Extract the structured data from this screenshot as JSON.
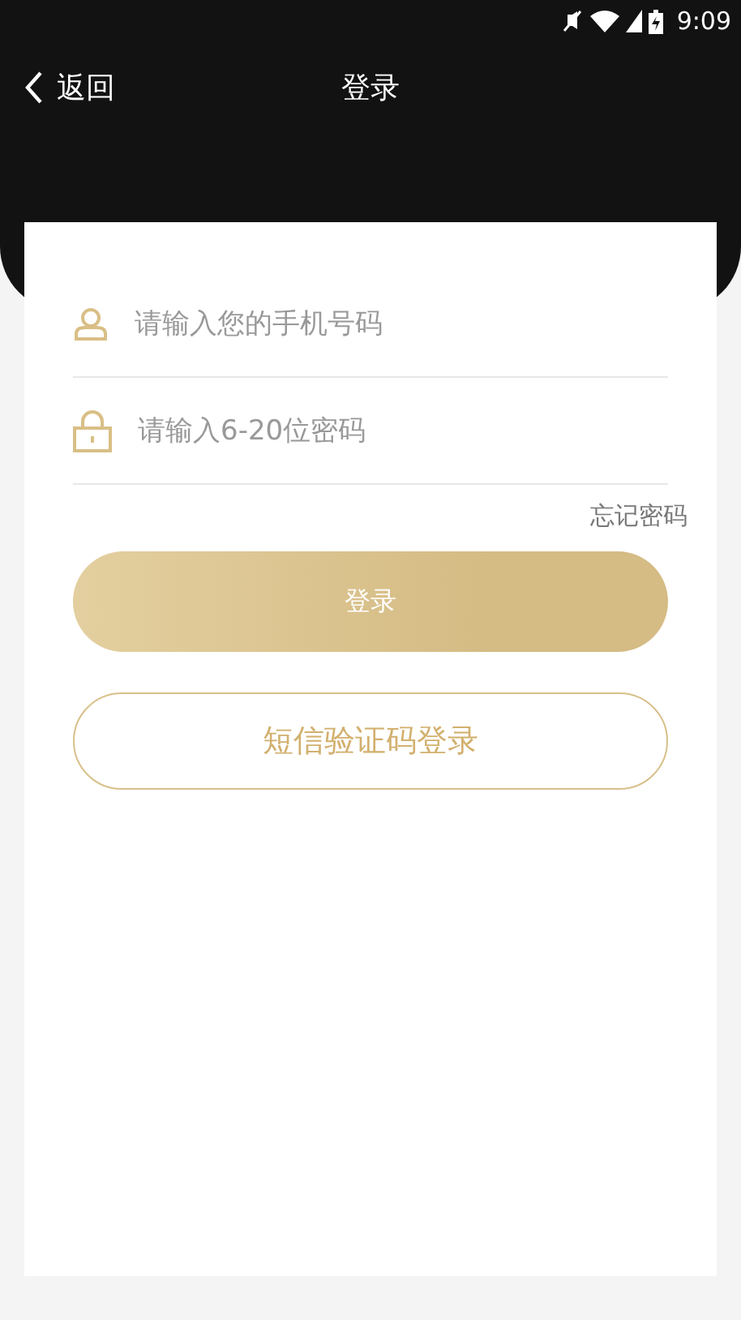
{
  "status_bar": {
    "time": "9:09"
  },
  "nav": {
    "back": "返回",
    "title": "登录"
  },
  "fields": [
    {
      "kind": "phone",
      "placeholder": "请输入您的手机号码"
    },
    {
      "kind": "password",
      "placeholder": "请输入6-20位密码"
    }
  ],
  "forgot_link": "忘记密码",
  "login_button": "登录",
  "sms_button": "短信验证码登录"
}
